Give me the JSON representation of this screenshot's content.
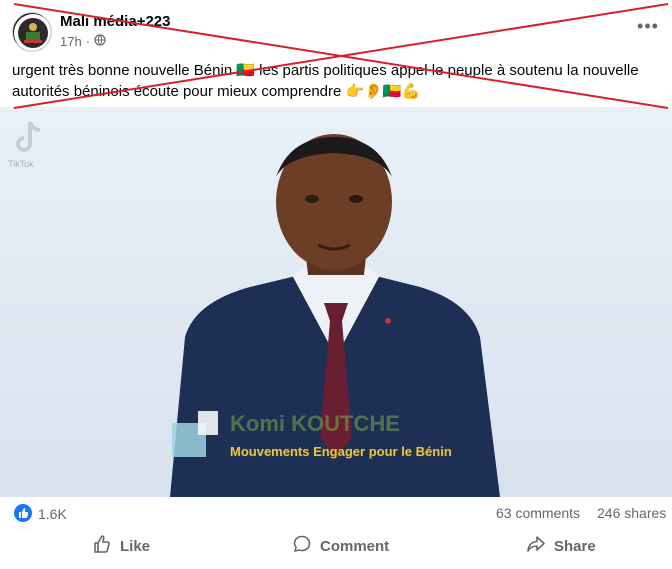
{
  "post": {
    "author": "Mali média+223",
    "time": "17h",
    "separator": "·",
    "text": "urgent très bonne nouvelle Bénin 🇧🇯 les partis politiques appel le peuple à soutenu la nouvelle autorités béninois écoute pour mieux comprendre 👉👂🇧🇯💪"
  },
  "video": {
    "watermark": "TikTok",
    "lower_third": {
      "name": "Komi KOUTCHE",
      "subtitle": "Mouvements Engager pour le Bénin"
    }
  },
  "stats": {
    "reactions": "1.6K",
    "comments": "63 comments",
    "shares": "246 shares"
  },
  "actions": {
    "like": "Like",
    "comment": "Comment",
    "share": "Share"
  },
  "colors": {
    "facebook_blue": "#1877f2",
    "cross_red": "#d8202a"
  }
}
